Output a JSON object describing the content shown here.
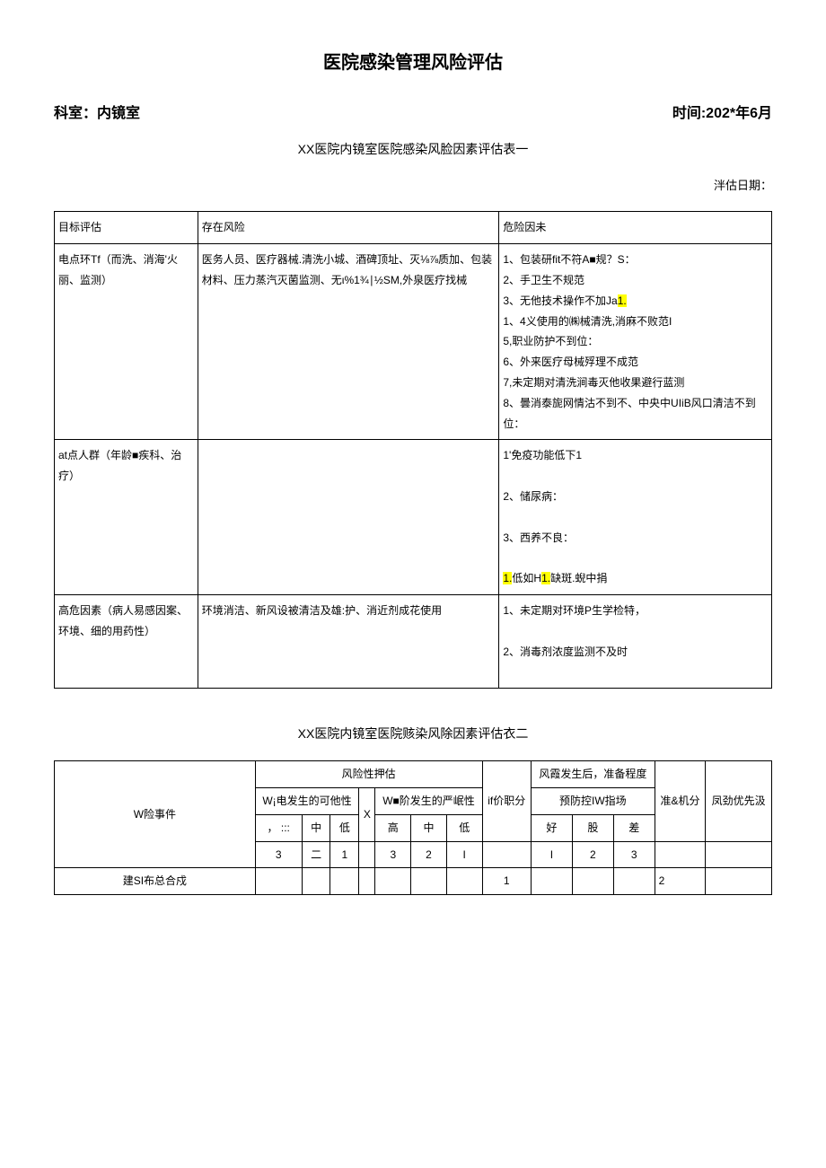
{
  "title": "医院感染管理风险评估",
  "department_label": "科室：内镜室",
  "time_label": "时间:202*年6月",
  "table1_title": "XX医院内镜室医院感染风脸因素评估表一",
  "eval_date_label": "泮估日期：",
  "table1": {
    "headers": [
      "目标评估",
      "存在风险",
      "危险因未"
    ],
    "rows": [
      {
        "c1": "电点环Tf（而洗、消海'火丽、监测）",
        "c2": "医务人员、医疗器械.清洗小城、酒碑顶址、灭⅛⅞质加、包装材料、压力蒸汽灭菌监测、无ι%1¾∣½SM,外泉医疗找械",
        "c3_parts": [
          {
            "t": "1、包装研fit不符A■规？S："
          },
          {
            "t": "2、手卫生不规范"
          },
          {
            "t": "3、无他技术操作不加Ja",
            "hl": "1."
          },
          {
            "t": "1、4义使用的㈱械清洗,消麻不败范I"
          },
          {
            "t": "5,职业防护不到位："
          },
          {
            "t": "6、外来医疗母械殍理不成范"
          },
          {
            "t": "7,未定期对清洗涧毒灭他收果避行蓝测"
          },
          {
            "t": "8、曇消泰旎网情沽不到不、中央中UIiB风口清洁不到位："
          }
        ]
      },
      {
        "c1": "at点人群（年龄■疾科、治疗）",
        "c2": "",
        "c3_parts": [
          {
            "t": "1'免疫功能低下1"
          },
          {
            "t": "2、储尿病："
          },
          {
            "t": "3、西养不良："
          },
          {
            "pre_hl": "1.",
            "t": "低如H",
            "mid_hl": "1.",
            "tail": "缺斑.蜺中捐"
          }
        ]
      },
      {
        "c1": "高危因素（病人易感因案、环境、细的用药性）",
        "c2": "环境消洁、新风设被清洁及雄:护、消近剂成花使用",
        "c3_parts": [
          {
            "t": "1、未定期对环境P生学检特，"
          },
          {
            "t": "2、消毒剂浓度监测不及时"
          }
        ]
      }
    ]
  },
  "table2_title": "XX医院内镜室医院赅染风除因素评估衣二",
  "table2": {
    "header_main": "风险性押估",
    "header_prep": "风霞发生后，准备程度",
    "col_event": "W险事件",
    "col_possibility": "W¡电发生的可他性",
    "col_x": "X",
    "col_severity": "W■阶发生的严岷性",
    "col_ifscore": "if价职分",
    "col_prevention": "预防控IW指场",
    "col_prepscore": "准&机分",
    "col_priority": "凤劲优先汲",
    "poss_levels": [
      "， :::",
      "中",
      "低"
    ],
    "sev_levels": [
      "高",
      "中",
      "低"
    ],
    "prev_levels": [
      "好",
      "股",
      "差"
    ],
    "scale_poss": [
      "3",
      "二",
      "1"
    ],
    "scale_sev": [
      "3",
      "2",
      "I"
    ],
    "scale_prev": [
      "I",
      "2",
      "3"
    ],
    "row1": {
      "event": "建SI布总合戍",
      "ifscore": "1",
      "prepscore": "2"
    }
  }
}
